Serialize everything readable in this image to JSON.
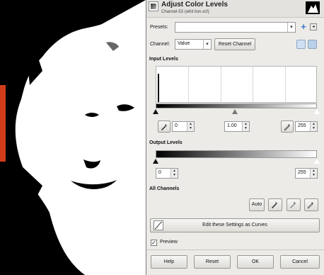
{
  "dialog": {
    "title": "Adjust Color Levels",
    "subtitle": "Channel-53 (whit lion.xcf)",
    "presets_label": "Presets:",
    "presets_value": "",
    "channel_label": "Channel:",
    "channel_value": "Value",
    "reset_channel_label": "Reset Channel",
    "input_levels_title": "Input Levels",
    "input_low": "0",
    "input_gamma": "1.00",
    "input_high": "255",
    "output_levels_title": "Output Levels",
    "output_low": "0",
    "output_high": "255",
    "all_channels_title": "All Channels",
    "auto_label": "Auto",
    "curves_label": "Edit these Settings as Curves",
    "preview_label": "Preview",
    "preview_checked": true,
    "buttons": {
      "help": "Help",
      "reset": "Reset",
      "ok": "OK",
      "cancel": "Cancel"
    }
  },
  "icons": {
    "add_preset": "plus-icon",
    "preset_menu": "menu-icon",
    "linear_histogram": "linear-histogram-icon",
    "log_histogram": "log-histogram-icon",
    "black_picker": "eyedropper-icon",
    "gray_picker": "eyedropper-icon",
    "white_picker": "eyedropper-icon",
    "curves": "curves-icon"
  },
  "colors": {
    "accent": "#3a78c4",
    "dialog_bg": "#ecebe8"
  }
}
